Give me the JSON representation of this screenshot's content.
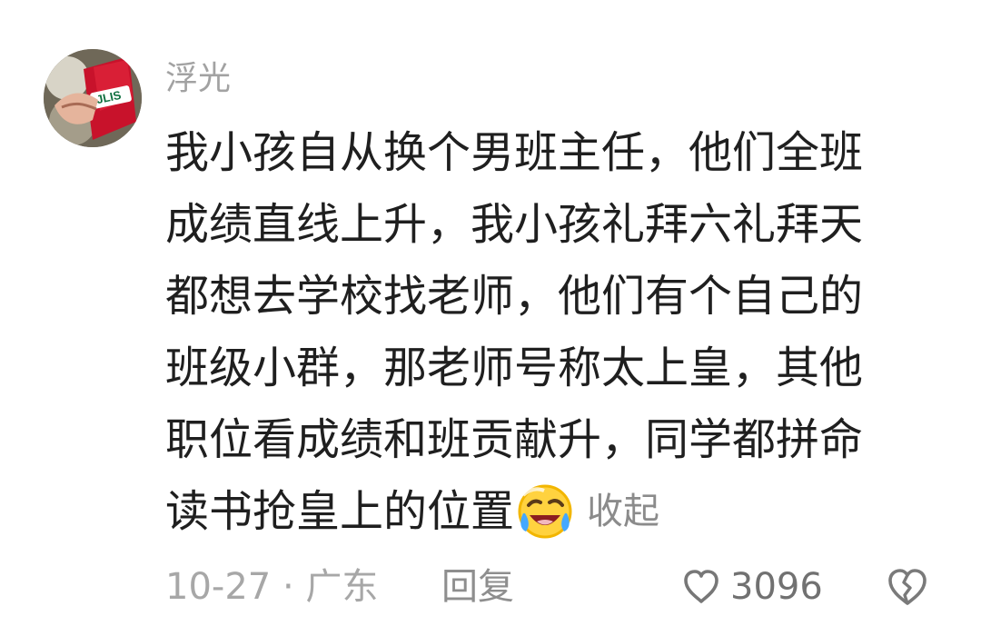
{
  "comment": {
    "username": "浮光",
    "lines": [
      "我小孩自从换个男班主任，他们全班",
      "成绩直线上升，我小孩礼拜六礼拜天",
      "都想去学校找老师，他们有个自己的",
      "班级小群，那老师号称太上皇，其他",
      "职位看成绩和班贡献升，同学都拼命"
    ],
    "last_line": "读书抢皇上的位置",
    "emoji": "laughing-crying-emoji",
    "collapse_label": "收起",
    "meta": "10-27 · 广东",
    "reply_label": "回复",
    "like_count": "3096",
    "icons": {
      "like": "heart-outline-icon",
      "dislike": "broken-heart-icon"
    },
    "colors": {
      "text": "#1f1f1f",
      "muted": "#a2a2a2",
      "background": "#ffffff"
    }
  }
}
